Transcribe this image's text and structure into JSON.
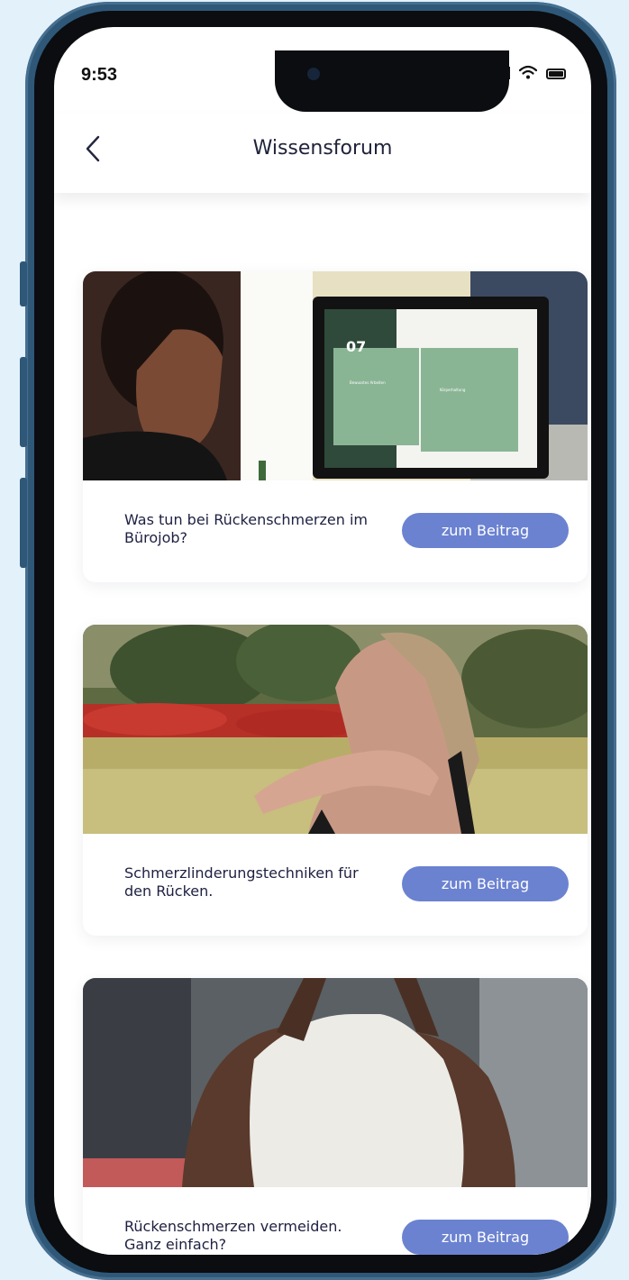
{
  "status_bar": {
    "time": "9:53",
    "icons": [
      "signal-icon",
      "wifi-icon",
      "battery-icon"
    ]
  },
  "header": {
    "back_icon": "chevron-left-icon",
    "title": "Wissensforum"
  },
  "theme": {
    "accent": "#6b82d1",
    "text_dark": "#1d2041",
    "frame": "#2f5878",
    "background": "#e3f1fb"
  },
  "posts": [
    {
      "title": "Was tun bei Rückenschmerzen im Bürojob?",
      "button_label": "zum Beitrag",
      "image": {
        "slide_number": "07",
        "slide_card_1": "Bewusstes Arbeiten",
        "slide_card_2": "Körperhaltung"
      }
    },
    {
      "title": "Schmerzlinderungstechniken für den Rücken.",
      "button_label": "zum Beitrag"
    },
    {
      "title": "Rückenschmerzen vermeiden. Ganz einfach?",
      "button_label": "zum Beitrag"
    }
  ]
}
